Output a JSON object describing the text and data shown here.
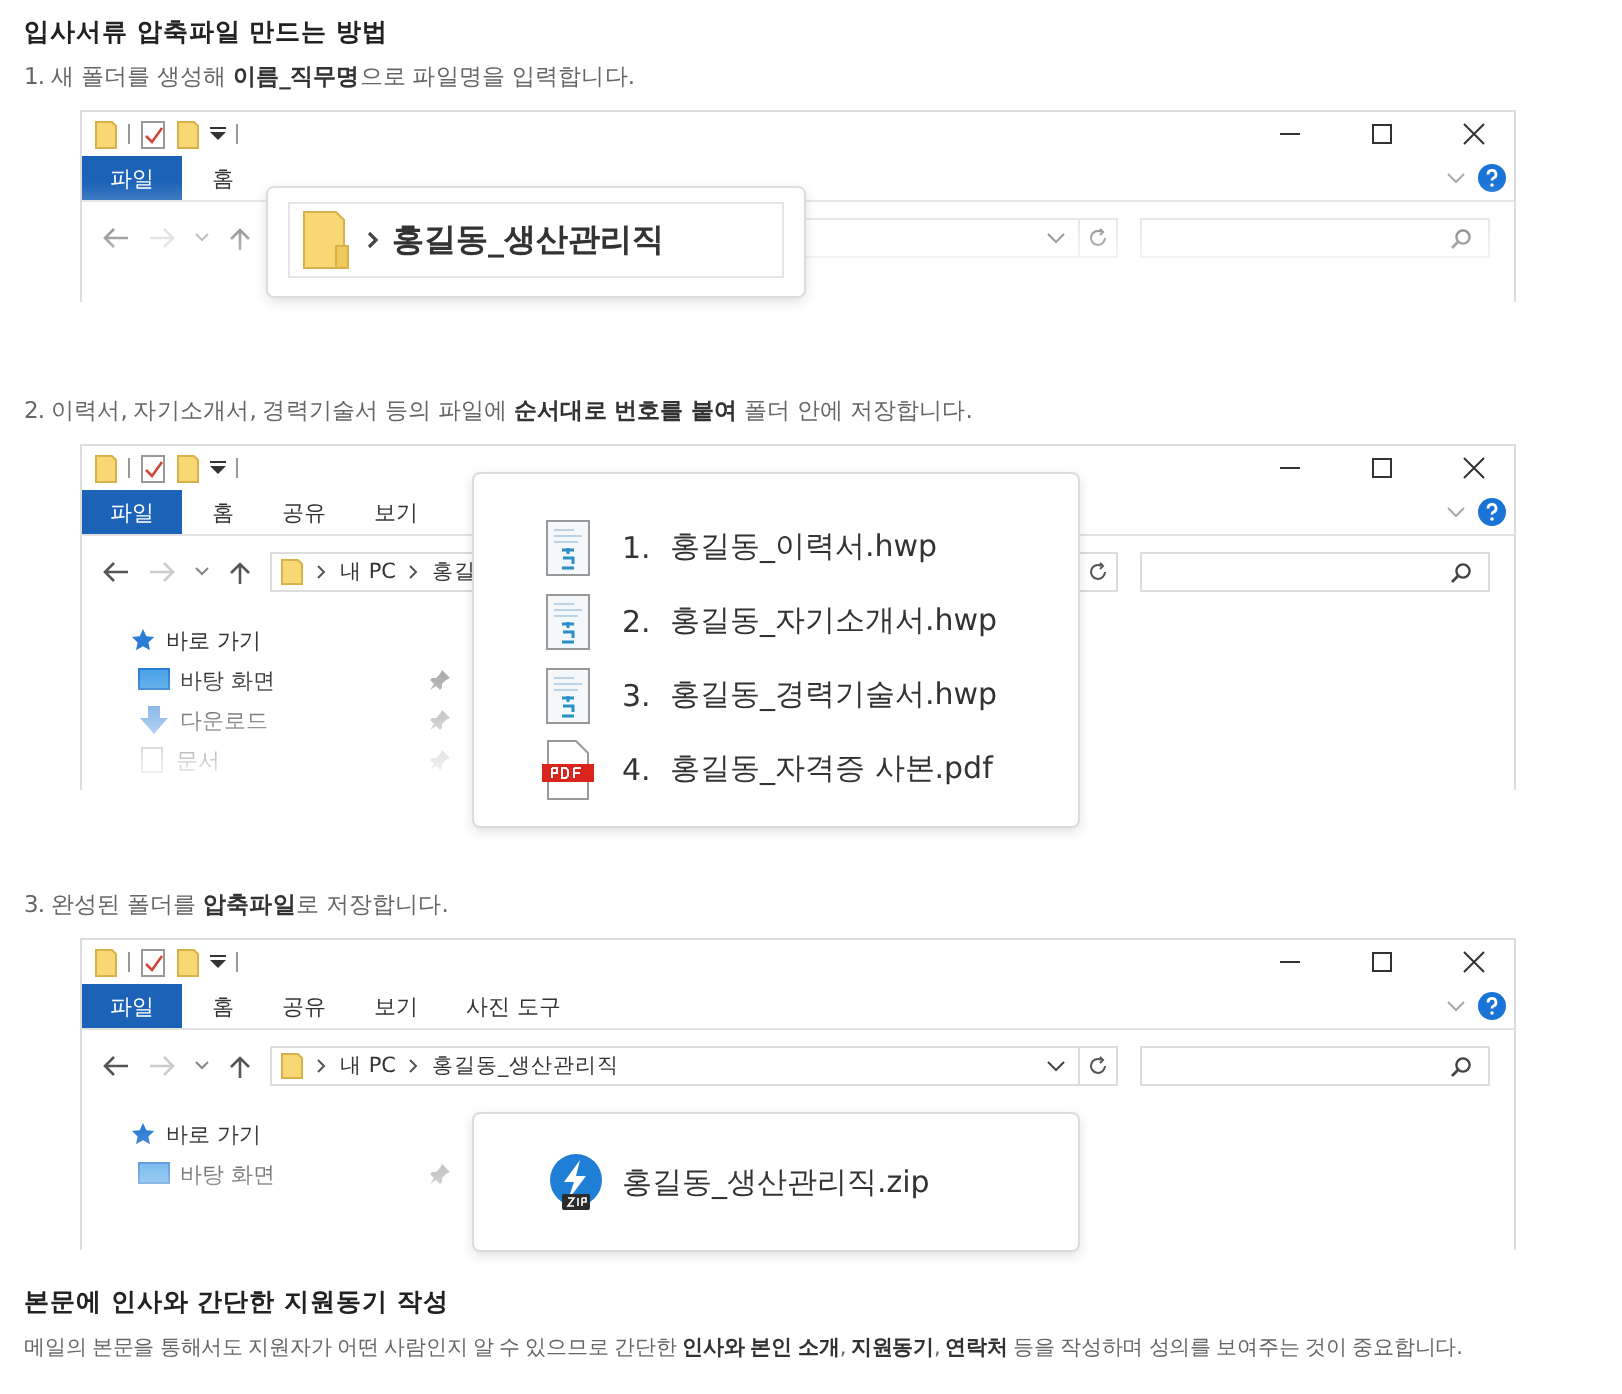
{
  "heading": "입사서류 압축파일 만드는 방법",
  "steps": [
    {
      "text": "1. 새 폴더를 생성해 **이름_직무명**으로 파일명을 입력합니다.",
      "window": {
        "tabs": [
          {
            "label": "파일",
            "selected": true
          },
          {
            "label": "홈",
            "selected": false
          }
        ]
      },
      "popup": {
        "kind": "folder",
        "items": [
          {
            "label": "홍길동_생산관리직",
            "kind": "folder"
          }
        ]
      }
    },
    {
      "text": "2. 이력서, 자기소개서, 경력기술서 등의 파일에 **순서대로 번호를 붙여** 폴더 안에 저장합니다.",
      "window": {
        "tabs": [
          {
            "label": "파일",
            "selected": true
          },
          {
            "label": "홈",
            "selected": false
          },
          {
            "label": "공유",
            "selected": false
          },
          {
            "label": "보기",
            "selected": false
          }
        ],
        "address": [
          "내 PC",
          "홍길"
        ],
        "sidebar": [
          {
            "label": "바로 가기",
            "kind": "star"
          },
          {
            "label": "바탕 화면",
            "kind": "desktop"
          },
          {
            "label": "다운로드",
            "kind": "download"
          },
          {
            "label": "문서",
            "kind": "document"
          }
        ]
      },
      "popup": {
        "kind": "files",
        "items": [
          {
            "number": "1.",
            "label": "홍길동_이력서.hwp",
            "kind": "hwp"
          },
          {
            "number": "2.",
            "label": "홍길동_자기소개서.hwp",
            "kind": "hwp"
          },
          {
            "number": "3.",
            "label": "홍길동_경력기술서.hwp",
            "kind": "hwp"
          },
          {
            "number": "4.",
            "label": "홍길동_자격증 사본.pdf",
            "kind": "pdf"
          }
        ]
      }
    },
    {
      "text": "3. 완성된 폴더를 **압축파일**로 저장합니다.",
      "window": {
        "tabs": [
          {
            "label": "파일",
            "selected": true
          },
          {
            "label": "홈",
            "selected": false
          },
          {
            "label": "공유",
            "selected": false
          },
          {
            "label": "보기",
            "selected": false
          },
          {
            "label": "사진 도구",
            "selected": false
          }
        ],
        "address": [
          "내 PC",
          "홍길동_생산관리직"
        ],
        "sidebar": [
          {
            "label": "바로 가기",
            "kind": "star"
          },
          {
            "label": "바탕 화면",
            "kind": "desktop"
          }
        ]
      },
      "popup": {
        "kind": "zip",
        "items": [
          {
            "label": "홍길동_생산관리직.zip",
            "kind": "zip"
          }
        ]
      }
    }
  ],
  "section": {
    "heading": "본문에 인사와 간단한 지원동기 작성",
    "text": "메일의 본문을 통해서도 지원자가 어떤 사람인지 알 수 있으므로 간단한 **인사와 본인 소개**, **지원동기**, **연락처** 등을 작성하며 성의를 보여주는 것이 중요합니다."
  }
}
